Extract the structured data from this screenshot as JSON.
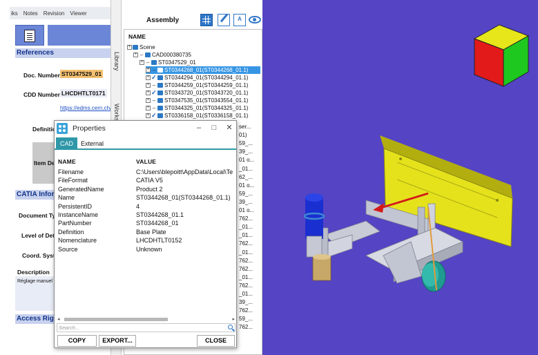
{
  "menu": [
    "iks",
    "Notes",
    "Revision",
    "Viewer"
  ],
  "left": {
    "references_heading": "References",
    "doc_number_label": "Doc. Number",
    "doc_number_value": "ST0347529_01",
    "cdd_number_label": "CDD Number",
    "cdd_number_value": "LHCDHTLT0171",
    "edms_link": "https://edms.cern.ch/",
    "definition_label": "Definition",
    "item_label": "Item De",
    "catia_heading": "CATIA Inform",
    "document_type_label": "Document Typ",
    "level_label": "Level of Deta",
    "coord_label": "Coord. Syste",
    "description_label": "Description",
    "description_text": "Réglage manuel un bouton molet",
    "access_heading": "Access Right"
  },
  "side_tabs": {
    "library": "Library",
    "workspace": "Workspace"
  },
  "assembly": {
    "title": "Assembly",
    "label_icon_text": "A",
    "tree_header": "NAME",
    "rows": [
      {
        "text": "Scene",
        "depth": 0,
        "state": "none"
      },
      {
        "text": "CAD000380735",
        "depth": 1,
        "state": "dash"
      },
      {
        "text": "ST0347529_01",
        "depth": 2,
        "state": "dash"
      },
      {
        "text": "ST0344268_01(ST0344268_01.1)",
        "depth": 3,
        "state": "dash",
        "selected": true
      },
      {
        "text": "ST0344294_01(ST0344294_01.1)",
        "depth": 3,
        "state": "check"
      },
      {
        "text": "ST0344259_01(ST0344259_01.1)",
        "depth": 3,
        "state": "dash"
      },
      {
        "text": "ST0343720_01(ST0343720_01.1)",
        "depth": 3,
        "state": "check"
      },
      {
        "text": "ST0347535_01(ST0343554_01.1)",
        "depth": 3,
        "state": "dash"
      },
      {
        "text": "ST0344325_01(ST0344325_01.1)",
        "depth": 3,
        "state": "dash"
      },
      {
        "text": "ST0336158_01(ST0336158_01.1)",
        "depth": 3,
        "state": "check"
      }
    ],
    "truncated": [
      "ser...",
      "01)",
      "59_...",
      "39_...",
      "01 o...",
      "_01...",
      "62_...",
      "01 o...",
      "59_...",
      "39_...",
      "01 o...",
      "762...",
      "_01...",
      "_01...",
      "762...",
      "_01...",
      "762...",
      "762...",
      "_01...",
      "762...",
      "_01...",
      "39_...",
      "762...",
      "59_...",
      "762..."
    ]
  },
  "properties": {
    "title": "Properties",
    "tabs": [
      "CAD",
      "External"
    ],
    "col_name": "NAME",
    "col_value": "VALUE",
    "rows": [
      {
        "name": "Filename",
        "value": "C:\\Users\\blepoitt\\AppData\\Local\\Te"
      },
      {
        "name": "FileFormat",
        "value": "CATIA V5"
      },
      {
        "name": "GeneratedName",
        "value": "Product 2"
      },
      {
        "name": "Name",
        "value": "ST0344268_01(ST0344268_01.1)"
      },
      {
        "name": "PersistentID",
        "value": "4"
      },
      {
        "name": "InstanceName",
        "value": "ST0344268_01.1"
      },
      {
        "name": "PartNumber",
        "value": "ST0344268_01"
      },
      {
        "name": "Definition",
        "value": "Base Plate"
      },
      {
        "name": "Nomenclature",
        "value": "LHCDHTLT0152"
      },
      {
        "name": "Source",
        "value": "Unknown"
      }
    ],
    "search_placeholder": "Search...",
    "copy_label": "COPY",
    "export_label": "EXPORT...",
    "close_label": "CLOSE",
    "minimize_glyph": "–",
    "maximize_glyph": "□",
    "close_glyph": "✕"
  },
  "colors": {
    "viewport_bg": "#5544c4",
    "accent": "#2e97a8",
    "selection": "#3796e4",
    "plate": "#e5e21c"
  }
}
